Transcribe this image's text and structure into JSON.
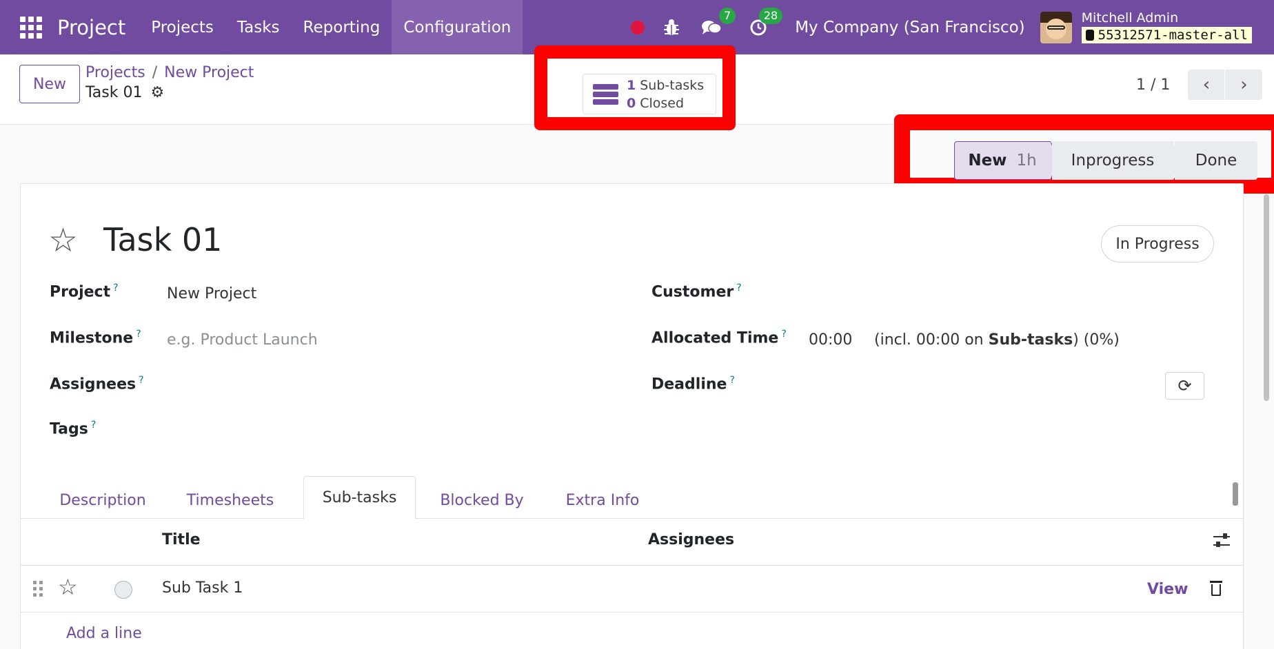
{
  "navbar": {
    "brand": "Project",
    "menu": [
      "Projects",
      "Tasks",
      "Reporting",
      "Configuration"
    ],
    "active_menu": "Configuration",
    "chat_count": "7",
    "activity_count": "28",
    "company": "My Company (San Francisco)",
    "user_name": "Mitchell Admin",
    "database": "55312571-master-all"
  },
  "control": {
    "new_label": "New",
    "breadcrumb": [
      "Projects",
      "New Project"
    ],
    "breadcrumb_sep": "/",
    "current": "Task 01",
    "stat": {
      "subtasks_count": "1",
      "subtasks_label": "Sub-tasks",
      "closed_count": "0",
      "closed_label": "Closed"
    },
    "pager": "1 / 1"
  },
  "status_bar": {
    "stages": [
      {
        "label": "New",
        "duration": "1h",
        "active": true
      },
      {
        "label": "Inprogress"
      },
      {
        "label": "Done"
      }
    ]
  },
  "form": {
    "title": "Task 01",
    "state": "In Progress",
    "fields": {
      "project_label": "Project",
      "project_value": "New Project",
      "milestone_label": "Milestone",
      "milestone_placeholder": "e.g. Product Launch",
      "assignees_label": "Assignees",
      "tags_label": "Tags",
      "customer_label": "Customer",
      "allocated_label": "Allocated Time",
      "allocated_value": "00:00",
      "allocated_note_pre": "(incl. 00:00 on ",
      "allocated_note_bold": "Sub-tasks",
      "allocated_note_post": ") (0%)",
      "deadline_label": "Deadline",
      "help_mark": "?"
    },
    "tabs": [
      "Description",
      "Timesheets",
      "Sub-tasks",
      "Blocked By",
      "Extra Info"
    ],
    "active_tab": "Sub-tasks",
    "table": {
      "columns": [
        "Title",
        "Assignees"
      ],
      "rows": [
        {
          "title": "Sub Task 1",
          "action": "View"
        }
      ],
      "add_line": "Add a line"
    }
  },
  "colors": {
    "brand": "#714b9f",
    "highlight": "#ff0000"
  }
}
